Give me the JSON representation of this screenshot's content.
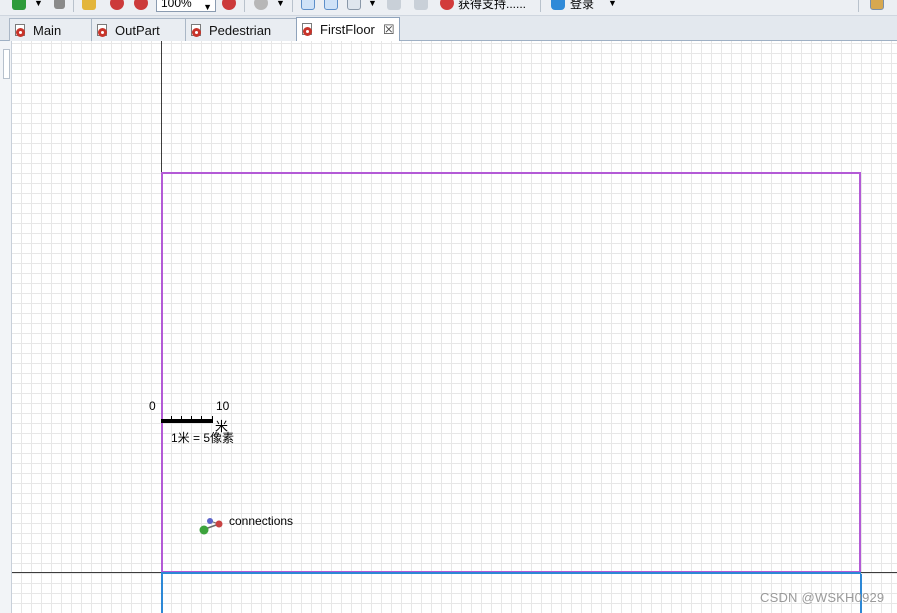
{
  "toolbar": {
    "zoom_value": "100%",
    "get_support_label": "获得支持......",
    "login_label": "登录"
  },
  "tabs": [
    {
      "label": "Main",
      "active": false
    },
    {
      "label": "OutPart",
      "active": false
    },
    {
      "label": "Pedestrian",
      "active": false
    },
    {
      "label": "FirstFloor",
      "active": true
    }
  ],
  "canvas": {
    "scale": {
      "start_label": "0",
      "end_label": "10",
      "unit_label": "米",
      "ratio_label": "1米 = 5像素"
    },
    "connections_label": "connections",
    "colors": {
      "floor_rect": "#b35ad6",
      "axis": "#3c3c3c",
      "axis_highlight": "#2d88d6",
      "grid": "#e7e7e7"
    }
  },
  "watermark": "CSDN @WSKH0929"
}
